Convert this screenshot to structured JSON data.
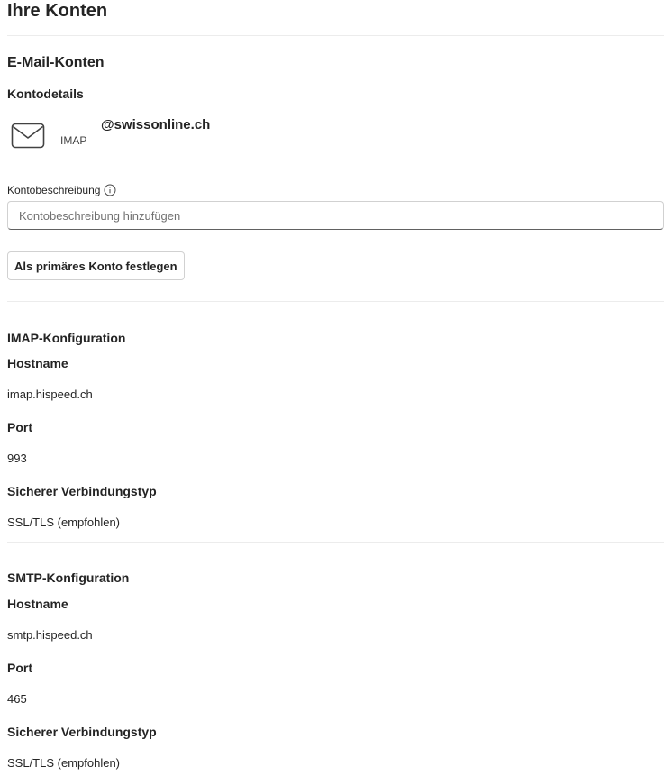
{
  "page": {
    "title": "Ihre Konten"
  },
  "email_accounts": {
    "heading": "E-Mail-Konten",
    "details_heading": "Kontodetails",
    "account": {
      "email": "@swissonline.ch",
      "type": "IMAP",
      "icon": "mail-icon"
    },
    "description_field": {
      "label": "Kontobeschreibung",
      "info_icon": "info-icon",
      "value": "",
      "placeholder": "Kontobeschreibung hinzufügen"
    },
    "primary_button_label": "Als primäres Konto festlegen"
  },
  "imap": {
    "heading": "IMAP-Konfiguration",
    "hostname_label": "Hostname",
    "hostname": "imap.hispeed.ch",
    "port_label": "Port",
    "port": "993",
    "security_label": "Sicherer Verbindungstyp",
    "security": "SSL/TLS (empfohlen)"
  },
  "smtp": {
    "heading": "SMTP-Konfiguration",
    "hostname_label": "Hostname",
    "hostname": "smtp.hispeed.ch",
    "port_label": "Port",
    "port": "465",
    "security_label": "Sicherer Verbindungstyp",
    "security": "SSL/TLS (empfohlen)"
  }
}
